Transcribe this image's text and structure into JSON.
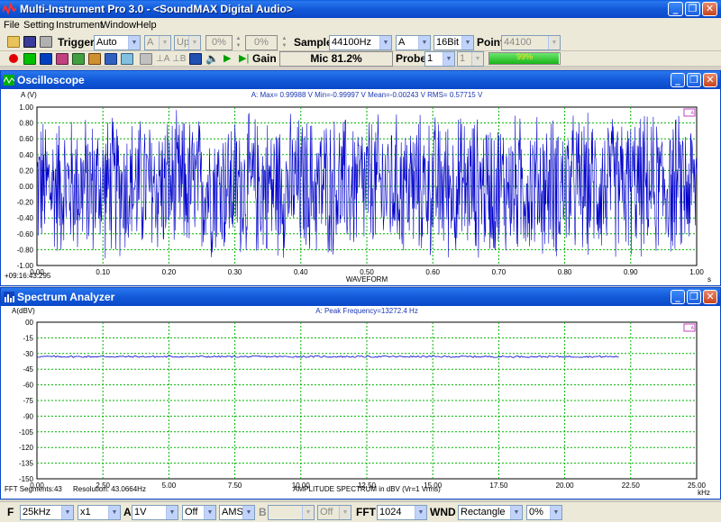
{
  "window": {
    "title": "Multi-Instrument Pro 3.0 - <SoundMAX Digital Audio>"
  },
  "menu": [
    "File",
    "Setting",
    "Instrument",
    "Window",
    "Help"
  ],
  "toolbar": {
    "trigger_label": "Trigger",
    "trigger_mode": "Auto",
    "channel_a": "A",
    "edge": "Up",
    "level1": "0%",
    "level2": "0%",
    "sample_label": "Sample",
    "sample_rate": "44100Hz",
    "sample_channel": "A",
    "bits": "16Bit",
    "point_label": "Point",
    "point_value": "44100",
    "gain_label": "Gain",
    "mic_level": "Mic 81.2%",
    "probe_label": "Probe",
    "probe_value": "1",
    "probe_value2": "1",
    "progress_text": "99%",
    "progress": 0.99
  },
  "oscilloscope": {
    "title": "Oscilloscope",
    "y_axis_label": "A (V)",
    "stats": "A: Max= 0.99988 V  Min=-0.99997 V  Mean=-0.00243 V  RMS= 0.57715 V",
    "timestamp": "+09:16:43:295",
    "x_caption": "WAVEFORM",
    "x_unit": "s",
    "y_ticks": [
      "1.00",
      "0.80",
      "0.60",
      "0.40",
      "0.20",
      "0.00",
      "-0.20",
      "-0.40",
      "-0.60",
      "-0.80",
      "-1.00"
    ],
    "x_ticks": [
      "0.00",
      "0.10",
      "0.20",
      "0.30",
      "0.40",
      "0.50",
      "0.60",
      "0.70",
      "0.80",
      "0.90",
      "1.00"
    ]
  },
  "spectrum": {
    "title": "Spectrum Analyzer",
    "y_axis_label": "A(dBV)",
    "stats": "A: Peak Frequency=13272.4 Hz",
    "fft_segments": "FFT Segments:43",
    "resolution": "Resolution: 43.0664Hz",
    "x_caption": "AMPLITUDE SPECTRUM in dBV (Vr=1 Vrms)",
    "x_unit": "kHz",
    "y_ticks": [
      "00",
      "-15",
      "-30",
      "-45",
      "-60",
      "-75",
      "-90",
      "-105",
      "-120",
      "-135",
      "-150"
    ],
    "x_ticks": [
      "0.00",
      "2.50",
      "5.00",
      "7.50",
      "10.00",
      "12.50",
      "15.00",
      "17.50",
      "20.00",
      "22.50",
      "25.00"
    ]
  },
  "bottombar": {
    "f_label": "F",
    "freq_range": "25kHz",
    "mult": "x1",
    "chan_a": "A",
    "volt": "1V",
    "off1": "Off",
    "ams": "AMS",
    "chan_b": "B",
    "b_combo1": "",
    "off2": "Off",
    "fft_label": "FFT",
    "fft_size": "1024",
    "wnd_label": "WND",
    "window_fn": "Rectangle",
    "overlap": "0%"
  },
  "chart_data": [
    {
      "type": "line",
      "title": "Oscilloscope",
      "xlabel": "WAVEFORM",
      "ylabel": "A (V)",
      "xlim": [
        0,
        1
      ],
      "ylim": [
        -1,
        1
      ],
      "grid": true,
      "series": [
        {
          "name": "A",
          "description_values": {
            "max": 0.99988,
            "min": -0.99997,
            "mean": -0.00243,
            "rms": 0.57715
          }
        }
      ]
    },
    {
      "type": "line",
      "title": "Spectrum Analyzer",
      "xlabel": "AMPLITUDE SPECTRUM in dBV (Vr=1 Vrms)",
      "ylabel": "A(dBV)",
      "xlim": [
        0,
        25
      ],
      "ylim": [
        -150,
        0
      ],
      "grid": true,
      "series": [
        {
          "name": "A",
          "x": [
            0,
            22.05
          ],
          "values": [
            -33,
            -33
          ]
        }
      ]
    }
  ],
  "colors": {
    "trace": "#0000cc",
    "grid": "#00b400",
    "titlebar": "#0a48c8"
  }
}
